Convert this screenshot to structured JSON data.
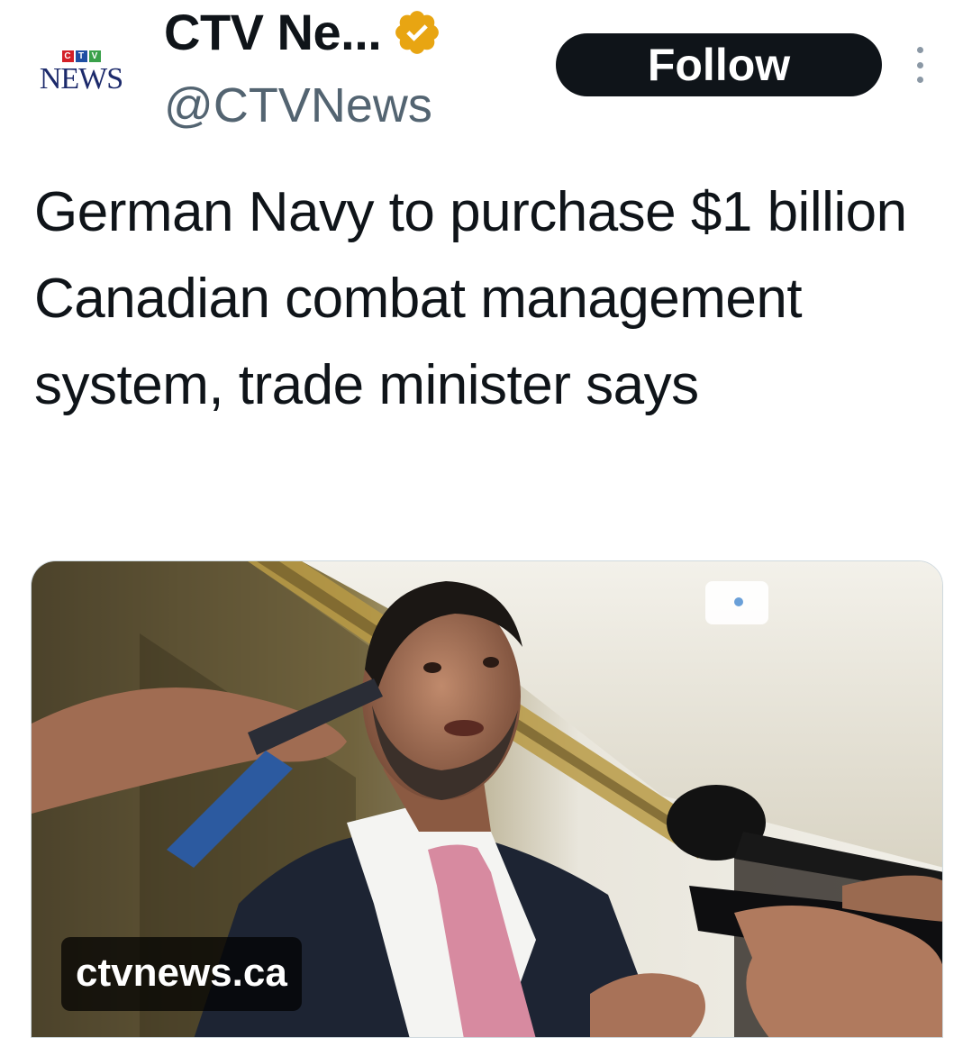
{
  "account": {
    "logo_letters": [
      "C",
      "T",
      "V"
    ],
    "logo_word": "NEWS",
    "display_name": "CTV Ne...",
    "handle": "@CTVNews",
    "verified_color": "#e8a512"
  },
  "actions": {
    "follow_label": "Follow",
    "more_icon": "more-vertical-icon"
  },
  "tweet": {
    "text": "German Navy to purchase $1 billion Canadian combat management system, trade minister says"
  },
  "media": {
    "source_label": "ctvnews.ca"
  },
  "colors": {
    "text": "#0f1419",
    "secondary": "#536471",
    "button": "#0f1419",
    "logo_red": "#d32027",
    "logo_blue": "#1f4fa3",
    "logo_green": "#3aa14a"
  }
}
